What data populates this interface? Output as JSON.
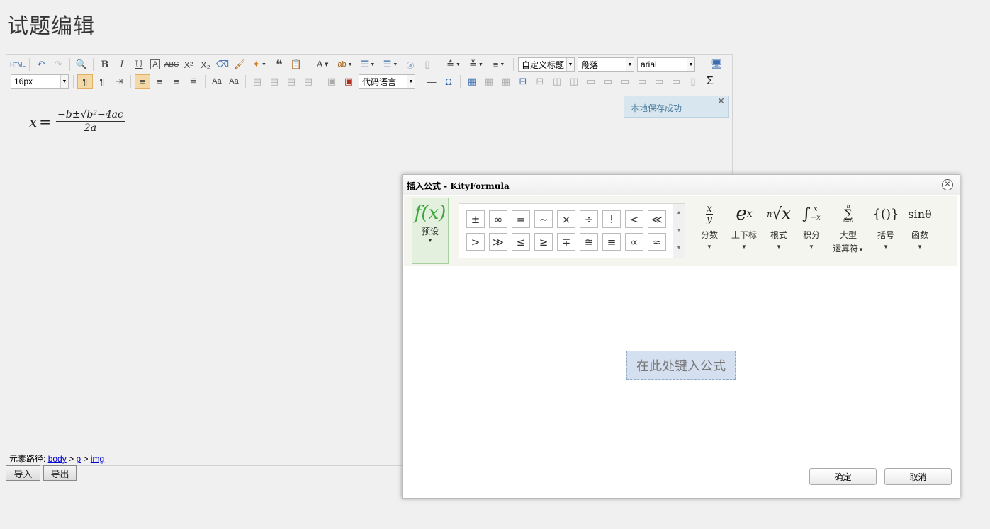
{
  "page_title": "试题编辑",
  "toolbar": {
    "font_size": "16px",
    "heading_select": "自定义标题",
    "paragraph_select": "段落",
    "font_family": "arial",
    "code_language": "代码语言",
    "html_label": "HTML"
  },
  "editor": {
    "formula": {
      "lhs": "x",
      "eq": "=",
      "numerator": "−b±√b²−4ac",
      "denominator": "2a"
    },
    "toast": "本地保存成功"
  },
  "statusbar": {
    "label": "元素路径:",
    "path": [
      "body",
      "p",
      "img"
    ],
    "separator": ">"
  },
  "buttons": {
    "import": "导入",
    "export": "导出"
  },
  "dialog": {
    "title": "插入公式 - KityFormula",
    "preset": {
      "icon": "f(x)",
      "label": "预设"
    },
    "symbols": [
      "±",
      "∞",
      "=",
      "~",
      "×",
      "÷",
      "!",
      "<",
      "≪",
      ">",
      "≫",
      "≤",
      "≥",
      "∓",
      "≅",
      "≡",
      "∝",
      "≈"
    ],
    "categories": [
      {
        "label": "分数",
        "icon": "x/y"
      },
      {
        "label": "上下标",
        "icon": "eˣ"
      },
      {
        "label": "根式",
        "icon": "ⁿ√x"
      },
      {
        "label": "积分",
        "icon": "∫"
      },
      {
        "label": "大型运算符",
        "label_line1": "大型",
        "label_line2": "运算符",
        "icon": "∑"
      },
      {
        "label": "括号",
        "icon": "{()}"
      },
      {
        "label": "函数",
        "icon": "sinθ"
      }
    ],
    "placeholder": "在此处键入公式",
    "ok": "确定",
    "cancel": "取消"
  }
}
